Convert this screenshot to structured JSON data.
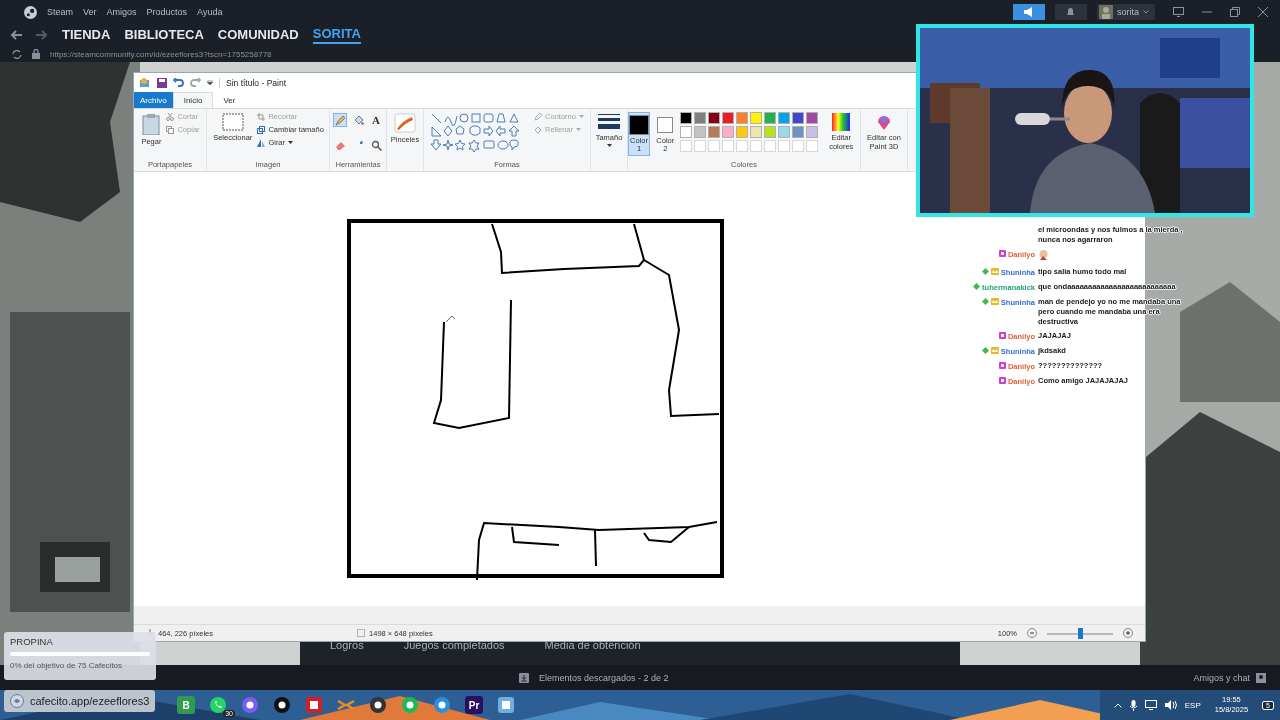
{
  "steam": {
    "menu": [
      "Steam",
      "Ver",
      "Amigos",
      "Productos",
      "Ayuda"
    ],
    "nav": [
      {
        "label": "TIENDA",
        "selected": false
      },
      {
        "label": "BIBLIOTECA",
        "selected": false
      },
      {
        "label": "COMUNIDAD",
        "selected": false
      },
      {
        "label": "SORITA",
        "selected": true
      }
    ],
    "url": "https://steamcommunity.com/id/ezeeflores3?tscn=1755258778",
    "user": "sorita",
    "profile_tabs": [
      "Logros",
      "Juegos completados",
      "Media de obtención"
    ],
    "downloads": "Elementos descargados - 2 de 2",
    "friends": "Amigos y chat"
  },
  "paint": {
    "title": "Sin título - Paint",
    "tabs": [
      {
        "label": "Archivo",
        "kind": "file",
        "selected": false
      },
      {
        "label": "Inicio",
        "kind": "tab",
        "selected": true
      },
      {
        "label": "Ver",
        "kind": "tab",
        "selected": false
      }
    ],
    "clipboard": {
      "label": "Portapapeles",
      "paste": "Pegar",
      "cut": {
        "label": "Cortar",
        "disabled": true
      },
      "copy": {
        "label": "Copiar",
        "disabled": true
      }
    },
    "image": {
      "label": "Imagen",
      "select": "Seleccionar",
      "crop": {
        "label": "Recortar",
        "disabled": true
      },
      "resize": {
        "label": "Cambiar tamaño",
        "disabled": false
      },
      "rotate": {
        "label": "Girar",
        "disabled": false
      }
    },
    "tools": {
      "label": "Herramientas",
      "items": [
        {
          "kind": "pencil",
          "selected": true
        },
        {
          "kind": "fill",
          "selected": false
        },
        {
          "kind": "text",
          "label": "A",
          "selected": false
        },
        {
          "kind": "eraser",
          "selected": false
        },
        {
          "kind": "picker",
          "selected": false
        },
        {
          "kind": "magnifier",
          "selected": false
        }
      ]
    },
    "brushes": "Pinceles",
    "shapes": {
      "label": "Formas",
      "outline": {
        "label": "Contorno",
        "disabled": true
      },
      "fill": {
        "label": "Rellenar",
        "disabled": true
      }
    },
    "size": "Tamaño",
    "color1": {
      "label": "Color 1",
      "color": "#000000",
      "selected": true
    },
    "color2": {
      "label": "Color 2",
      "color": "#ffffff",
      "selected": false
    },
    "colors_label": "Colores",
    "palette": [
      {
        "color": "#000000"
      },
      {
        "color": "#7f7f7f"
      },
      {
        "color": "#880015"
      },
      {
        "color": "#ed1c24"
      },
      {
        "color": "#ff7f27"
      },
      {
        "color": "#fff200"
      },
      {
        "color": "#22b14c"
      },
      {
        "color": "#00a2e8"
      },
      {
        "color": "#3f48cc"
      },
      {
        "color": "#a349a4"
      },
      {
        "color": "#ffffff"
      },
      {
        "color": "#c3c3c3"
      },
      {
        "color": "#b97a57"
      },
      {
        "color": "#ffaec9"
      },
      {
        "color": "#ffc90e"
      },
      {
        "color": "#efe4b0"
      },
      {
        "color": "#b5e61d"
      },
      {
        "color": "#99d9ea"
      },
      {
        "color": "#7092be"
      },
      {
        "color": "#c8bfe7"
      }
    ],
    "edit_colors": "Editar colores",
    "paint3d": "Editar con Paint 3D",
    "status": {
      "cursor": "464, 226 píxeles",
      "size": "1498 × 648 píxeles",
      "zoom": "100%",
      "slider": {
        "level": 0.5
      }
    }
  },
  "chat": [
    {
      "text": "el microondas y nos fulmos a la mierda , nunca nos agarraron",
      "kind": "text"
    },
    {
      "user": "Danilyo",
      "badges": [
        {
          "kind": "sub"
        }
      ],
      "kind": "emote",
      "color": "#e0603a"
    },
    {
      "user": "Shuninha",
      "badges": [
        {
          "kind": "gem"
        },
        {
          "kind": "crown"
        }
      ],
      "text": "tipo salia humo todo mal",
      "kind": "text",
      "color": "#2f6fd0"
    },
    {
      "user": "tuhermanakick",
      "badges": [
        {
          "kind": "gem"
        }
      ],
      "text": "que ondaaaaaaaaaaaaaaaaaaaaaaaaaa",
      "kind": "text",
      "color": "#1fa37a"
    },
    {
      "user": "Shuninha",
      "badges": [
        {
          "kind": "gem"
        },
        {
          "kind": "crown"
        }
      ],
      "text": "man de pendejo yo no me mandaba una pero cuando me mandaba una era destructiva",
      "kind": "text",
      "color": "#2f6fd0"
    },
    {
      "user": "Danilyo",
      "badges": [
        {
          "kind": "sub"
        }
      ],
      "text": "JAJAJAJ",
      "kind": "text",
      "color": "#e0603a"
    },
    {
      "user": "Shuninha",
      "badges": [
        {
          "kind": "gem"
        },
        {
          "kind": "crown"
        }
      ],
      "text": "jkdsakd",
      "kind": "text",
      "color": "#2f6fd0"
    },
    {
      "user": "Danilyo",
      "badges": [
        {
          "kind": "sub"
        }
      ],
      "text": "??????????????",
      "kind": "text",
      "color": "#e0603a"
    },
    {
      "user": "Danilyo",
      "badges": [
        {
          "kind": "sub"
        }
      ],
      "text": "Como amigo JAJAJAJAJ",
      "kind": "text",
      "color": "#e0603a"
    }
  ],
  "tip": {
    "title": "PROPINA",
    "level": 0,
    "goal": "0% del objetivo de 75 Cafecitos",
    "link": "cafecito.app/ezeeflores3"
  },
  "taskbar": {
    "apps": [
      {
        "kind": "letter",
        "label": "B",
        "color": "#2e9b4f"
      },
      {
        "kind": "whatsapp",
        "badge": "30",
        "color": "#25d366"
      },
      {
        "kind": "circle",
        "color": "#7b5cf0"
      },
      {
        "kind": "circle",
        "color": "#111111"
      },
      {
        "kind": "square",
        "color": "#d0202a"
      },
      {
        "kind": "arrows",
        "color": "#f08a1c"
      },
      {
        "kind": "circle",
        "color": "#333333"
      },
      {
        "kind": "circle",
        "color": "#1db954"
      },
      {
        "kind": "circle",
        "color": "#2d8ee0"
      },
      {
        "kind": "letter",
        "label": "Pr",
        "color": "#2a1160"
      },
      {
        "kind": "square",
        "color": "#6fb0e0"
      }
    ],
    "lang": "ESP",
    "time": "19:55",
    "date": "15/8/2025",
    "notifications": "5"
  }
}
